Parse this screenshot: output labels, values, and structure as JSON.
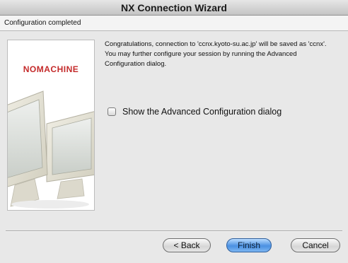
{
  "window": {
    "title": "NX Connection Wizard"
  },
  "header": {
    "text": "Configuration completed"
  },
  "sidebar": {
    "logo_text": "NOMACHINE"
  },
  "message": {
    "text": "Congratulations, connection to 'ccnx.kyoto-su.ac.jp' will be saved as 'ccnx'. You may further configure your session by running the Advanced Configuration dialog."
  },
  "option": {
    "label": "Show the Advanced Configuration dialog",
    "checked": false
  },
  "buttons": {
    "back": "< Back",
    "finish": "Finish",
    "cancel": "Cancel"
  },
  "colors": {
    "logo": "#c42a2a",
    "default_button": "#4a90e2"
  }
}
